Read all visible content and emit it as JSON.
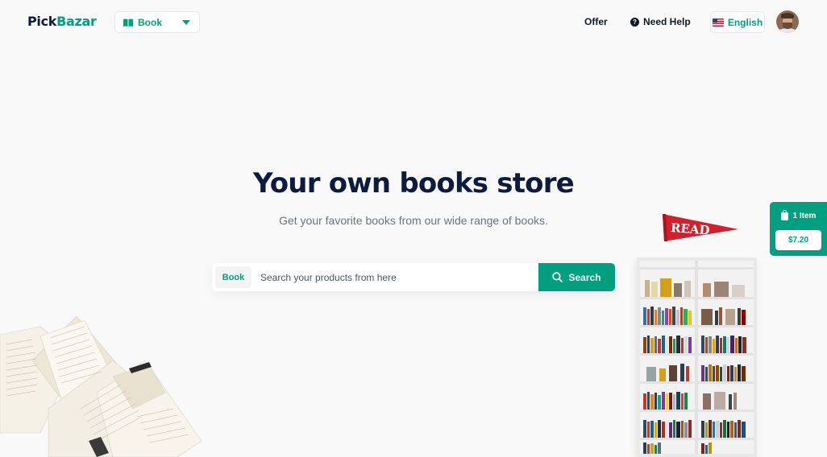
{
  "header": {
    "logo_part1": "Pick",
    "logo_part2": "Bazar",
    "type_selector": {
      "icon": "book-icon",
      "label": "Book"
    },
    "nav": {
      "offer": "Offer",
      "need_help": "Need Help",
      "help_icon": "question-icon"
    },
    "language": {
      "label": "English",
      "flag": "us-flag-icon"
    },
    "avatar": "user-avatar"
  },
  "hero": {
    "title": "Your own books store",
    "subtitle": "Get your favorite books from our wide range of books."
  },
  "search": {
    "category_chip": "Book",
    "placeholder": "Search your products from here",
    "button_label": "Search",
    "button_icon": "search-icon"
  },
  "cart": {
    "items_label": "1 Item",
    "total": "$7.20",
    "icon": "shopping-bag-icon"
  },
  "decor": {
    "pennant_text": "READ"
  },
  "colors": {
    "accent": "#009f7f",
    "heading": "#0d1b3e",
    "background": "#f9f9f9",
    "pennant": "#d21f2c"
  }
}
